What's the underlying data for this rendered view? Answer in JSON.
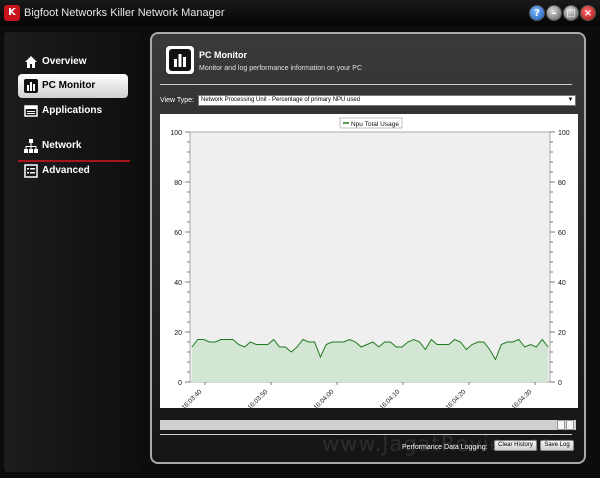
{
  "window": {
    "title": "Bigfoot Networks Killer Network Manager",
    "app_icon": "killer-logo-icon",
    "buttons": [
      "help-icon",
      "minimize-icon",
      "maximize-icon",
      "close-icon"
    ]
  },
  "sidebar": {
    "items": [
      {
        "label": "Overview",
        "icon": "home-icon",
        "active": false
      },
      {
        "label": "PC Monitor",
        "icon": "bar-chart-icon",
        "active": true
      },
      {
        "label": "Applications",
        "icon": "applications-icon",
        "active": false
      },
      {
        "label": "Network",
        "icon": "network-icon",
        "active": false
      },
      {
        "label": "Advanced",
        "icon": "advanced-list-icon",
        "active": false
      }
    ]
  },
  "header": {
    "title": "PC Monitor",
    "subtitle": "Monitor and log performance information on your PC"
  },
  "view_type": {
    "label": "View Type:",
    "selected": "Network Processing Unit - Percentage of primary NPU used"
  },
  "logging": {
    "label": "Performance Data Logging:",
    "clear_label": "Clear History",
    "save_label": "Save Log"
  },
  "watermark": "www.JagatReview.com",
  "colors": {
    "line": "#1f7a1f",
    "fill": "#d3e6d3",
    "plot_bg": "#efefef",
    "accent_red": "#a8141a"
  },
  "chart_data": {
    "type": "area",
    "legend": [
      "Npu Total Usage"
    ],
    "legend_position": "top-center",
    "ylim": [
      0,
      100
    ],
    "y_ticks": [
      0,
      20,
      40,
      60,
      80,
      100
    ],
    "x_ticks": [
      "16:03:40",
      "16:03:50",
      "16:04:00",
      "16:04:10",
      "16:04:20",
      "16:04:30"
    ],
    "grid": false,
    "series": [
      {
        "name": "Npu Total Usage",
        "values": [
          14,
          17,
          17,
          16,
          16,
          17,
          17,
          17,
          15,
          14,
          16,
          15,
          15,
          15,
          17,
          14,
          14,
          12,
          14,
          17,
          16,
          16,
          10,
          15,
          16,
          16,
          16,
          17,
          16,
          14,
          15,
          16,
          14,
          16,
          16,
          14,
          14,
          16,
          17,
          16,
          13,
          17,
          15,
          15,
          15,
          17,
          16,
          13,
          15,
          16,
          16,
          13,
          9,
          15,
          16,
          16,
          17,
          14,
          15,
          14,
          17,
          14
        ]
      }
    ]
  }
}
